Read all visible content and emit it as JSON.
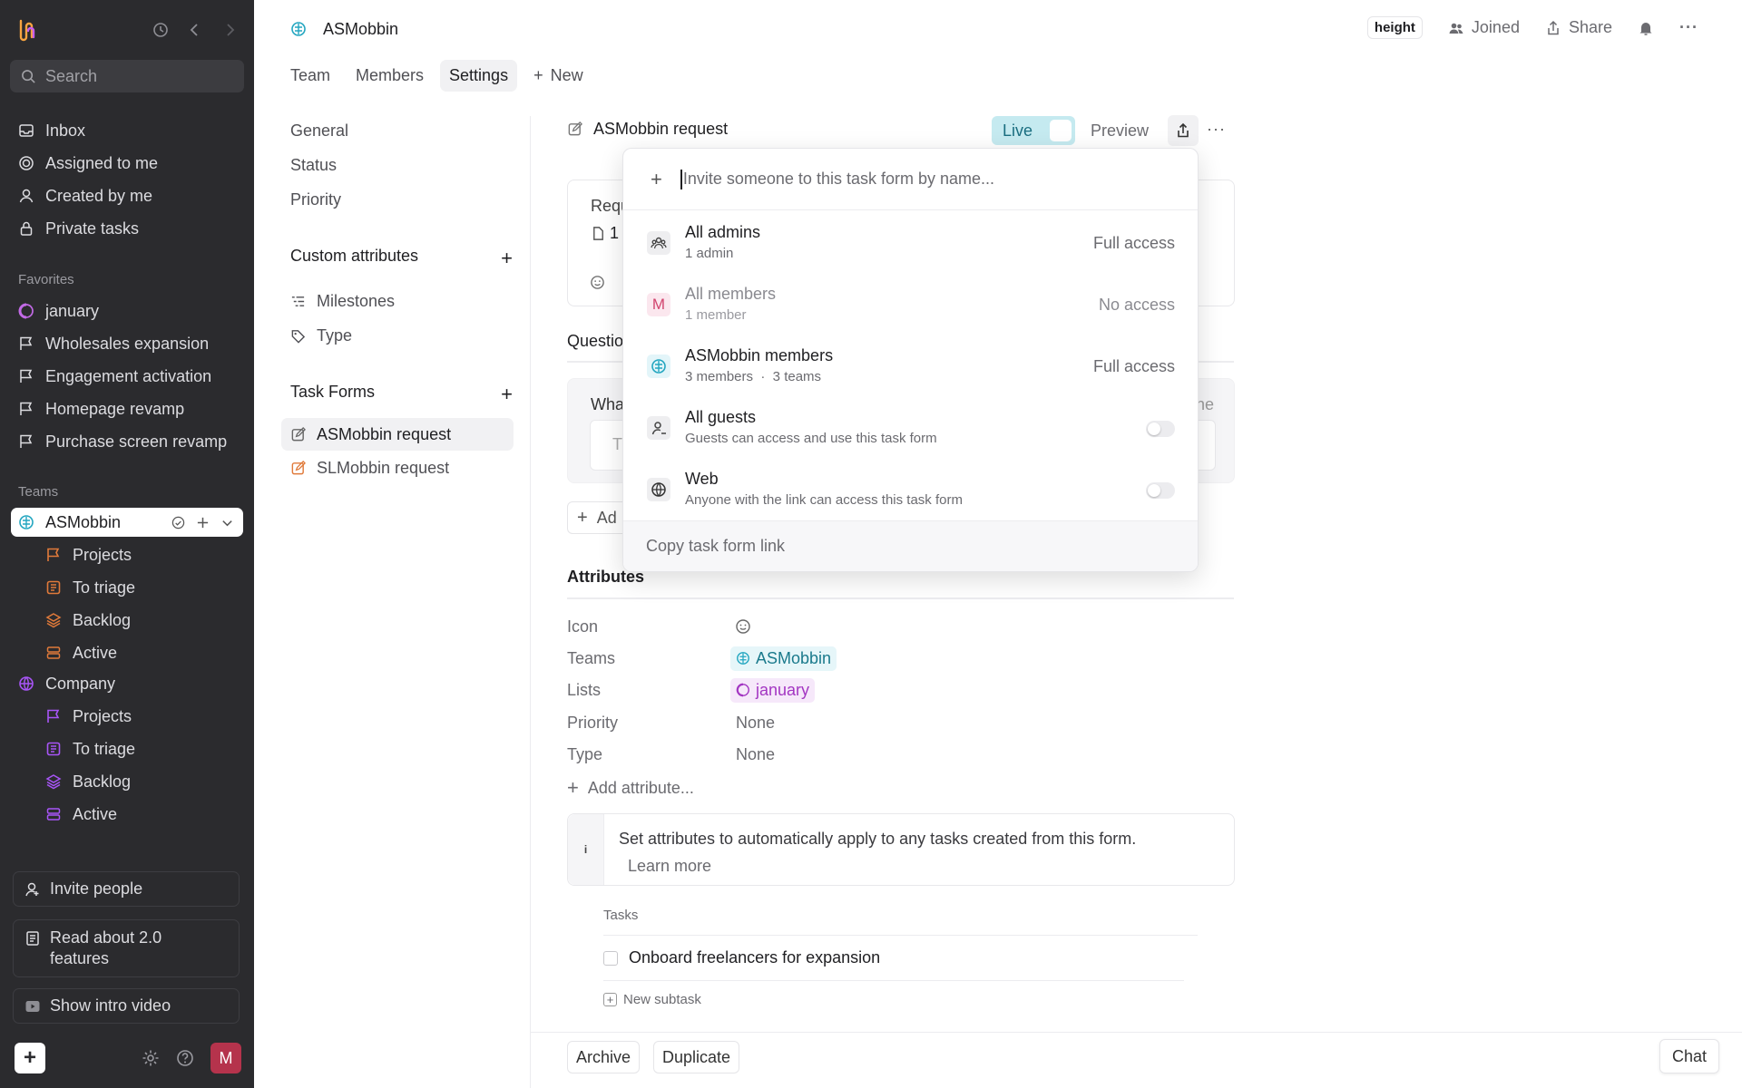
{
  "sidebar": {
    "search_placeholder": "Search",
    "nav": [
      "Inbox",
      "Assigned to me",
      "Created by me",
      "Private tasks"
    ],
    "favorites_title": "Favorites",
    "favorites": [
      "january",
      "Wholesales expansion",
      "Engagement activation",
      "Homepage revamp",
      "Purchase screen revamp"
    ],
    "teams_title": "Teams",
    "team1": {
      "name": "ASMobbin",
      "items": [
        "Projects",
        "To triage",
        "Backlog",
        "Active"
      ]
    },
    "team2": {
      "name": "Company",
      "items": [
        "Projects",
        "To triage",
        "Backlog",
        "Active"
      ]
    },
    "invite": "Invite people",
    "read_about": "Read about 2.0 features",
    "intro_video": "Show intro video",
    "avatar_letter": "M",
    "colors": {
      "bg": "#2b2b2e",
      "team1_accent": "#e07a3a",
      "team2_accent": "#a855f7",
      "avatar": "#b5334c"
    }
  },
  "header": {
    "title": "ASMobbin",
    "height_badge": "height",
    "joined": "Joined",
    "share": "Share",
    "tabs": [
      "Team",
      "Members",
      "Settings",
      "New"
    ]
  },
  "settings_nav": {
    "general": "General",
    "status": "Status",
    "priority": "Priority",
    "custom_attributes": "Custom attributes",
    "milestones": "Milestones",
    "type": "Type",
    "task_forms": "Task Forms",
    "forms": [
      "ASMobbin request",
      "SLMobbin request"
    ]
  },
  "form": {
    "title": "ASMobbin request",
    "live": "Live",
    "preview": "Preview",
    "card_text": "Requ",
    "card_badge": "1",
    "questions_text": "Questio",
    "what_text": "Wha",
    "t_text": "T",
    "ne_text": "ne",
    "add_text": "Ad"
  },
  "attributes": {
    "title": "Attributes",
    "rows": {
      "icon": "Icon",
      "teams": "Teams",
      "teams_value": "ASMobbin",
      "lists": "Lists",
      "lists_value": "january",
      "priority": "Priority",
      "priority_value": "None",
      "type": "Type",
      "type_value": "None"
    },
    "add_attribute": "Add attribute...",
    "info_icon": "i",
    "info_text": "Set attributes to automatically apply to any tasks created from this form.",
    "learn_more": "Learn more"
  },
  "tasks": {
    "label": "Tasks",
    "items": [
      "Onboard freelancers for expansion"
    ],
    "new_subtask": "New subtask"
  },
  "footer": {
    "archive": "Archive",
    "duplicate": "Duplicate",
    "chat": "Chat"
  },
  "popover": {
    "placeholder": "Invite someone to this task form by name...",
    "rows": [
      {
        "name": "All admins",
        "sub": "1 admin",
        "access": "Full access",
        "icon": "users-icon"
      },
      {
        "name": "All members",
        "sub": "1 member",
        "access": "No access",
        "icon": "m-letter-icon",
        "letter": "M"
      },
      {
        "name": "ASMobbin members",
        "sub": "3 members  ·  3 teams",
        "access": "Full access",
        "icon": "team-brain-icon"
      },
      {
        "name": "All guests",
        "sub": "Guests can access and use this task form",
        "toggle": false,
        "icon": "guest-icon"
      },
      {
        "name": "Web",
        "sub": "Anyone with the link can access this task form",
        "toggle": false,
        "icon": "globe-icon"
      }
    ],
    "copy_link": "Copy task form link"
  }
}
